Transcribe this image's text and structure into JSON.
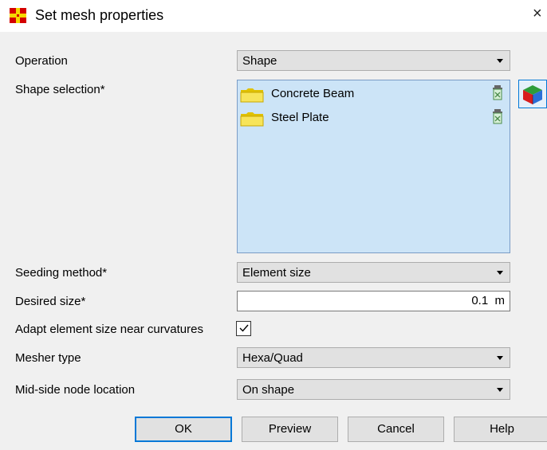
{
  "dialog": {
    "title": "Set mesh properties",
    "close_glyph": "×"
  },
  "fields": {
    "operation": {
      "label": "Operation",
      "value": "Shape"
    },
    "shape_selection": {
      "label": "Shape selection*",
      "items": [
        {
          "name": "Concrete Beam",
          "icon": "folder-icon"
        },
        {
          "name": "Steel Plate",
          "icon": "folder-icon"
        }
      ]
    },
    "seeding_method": {
      "label": "Seeding method*",
      "value": "Element size"
    },
    "desired_size": {
      "label": "Desired size*",
      "value": "0.1  m"
    },
    "adapt_curvature": {
      "label": "Adapt element size near curvatures",
      "checked": true
    },
    "mesher_type": {
      "label": "Mesher type",
      "value": "Hexa/Quad"
    },
    "mid_side": {
      "label": "Mid-side node location",
      "value": "On shape"
    }
  },
  "buttons": {
    "ok": "OK",
    "preview": "Preview",
    "cancel": "Cancel",
    "help": "Help"
  },
  "colors": {
    "accent": "#0078d7",
    "list_selection": "#cce4f7",
    "panel": "#f0f0f0"
  }
}
